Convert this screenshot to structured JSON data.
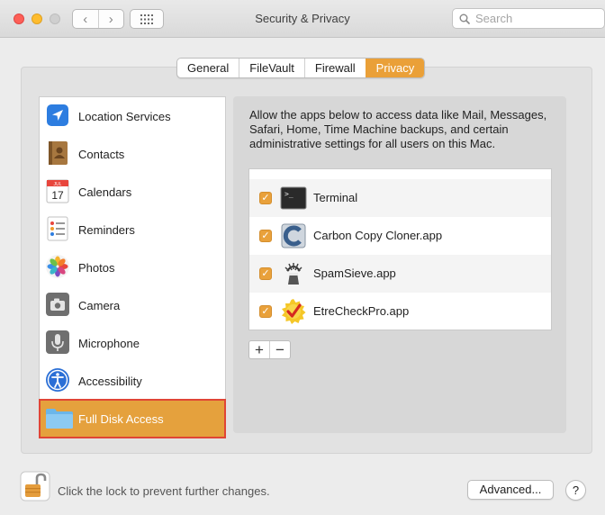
{
  "window": {
    "title": "Security & Privacy",
    "back_glyph": "‹",
    "forward_glyph": "›"
  },
  "search": {
    "placeholder": "Search",
    "value": ""
  },
  "tabs": [
    {
      "label": "General",
      "active": false
    },
    {
      "label": "FileVault",
      "active": false
    },
    {
      "label": "Firewall",
      "active": false
    },
    {
      "label": "Privacy",
      "active": true
    }
  ],
  "sidebar": {
    "items": [
      {
        "label": "Location Services",
        "icon": "location-arrow-icon"
      },
      {
        "label": "Contacts",
        "icon": "contacts-book-icon"
      },
      {
        "label": "Calendars",
        "icon": "calendar-icon",
        "icon_text": "17",
        "icon_month": "JUL"
      },
      {
        "label": "Reminders",
        "icon": "reminders-list-icon"
      },
      {
        "label": "Photos",
        "icon": "photos-flower-icon"
      },
      {
        "label": "Camera",
        "icon": "camera-icon"
      },
      {
        "label": "Microphone",
        "icon": "microphone-icon"
      },
      {
        "label": "Accessibility",
        "icon": "accessibility-icon"
      },
      {
        "label": "Full Disk Access",
        "icon": "folder-icon",
        "selected": true
      }
    ]
  },
  "detail": {
    "description": "Allow the apps below to access data like Mail, Messages, Safari, Home, Time Machine backups, and certain administrative settings for all users on this Mac.",
    "apps": [
      {
        "label": "Terminal",
        "checked": true,
        "icon": "terminal-icon",
        "icon_text": ">_"
      },
      {
        "label": "Carbon Copy Cloner.app",
        "checked": true,
        "icon": "carbon-copy-cloner-icon"
      },
      {
        "label": "SpamSieve.app",
        "checked": true,
        "icon": "spamsieve-icon"
      },
      {
        "label": "EtreCheckPro.app",
        "checked": true,
        "icon": "etrecheck-icon"
      }
    ],
    "add_label": "+",
    "remove_label": "−",
    "check_glyph": "✓"
  },
  "footer": {
    "lock_text": "Click the lock to prevent further changes.",
    "advanced_label": "Advanced...",
    "help_label": "?"
  },
  "colors": {
    "accent": "#e5a13d",
    "selection_outline": "#e04535",
    "close": "#fd5f57",
    "minimize": "#febc2e"
  }
}
